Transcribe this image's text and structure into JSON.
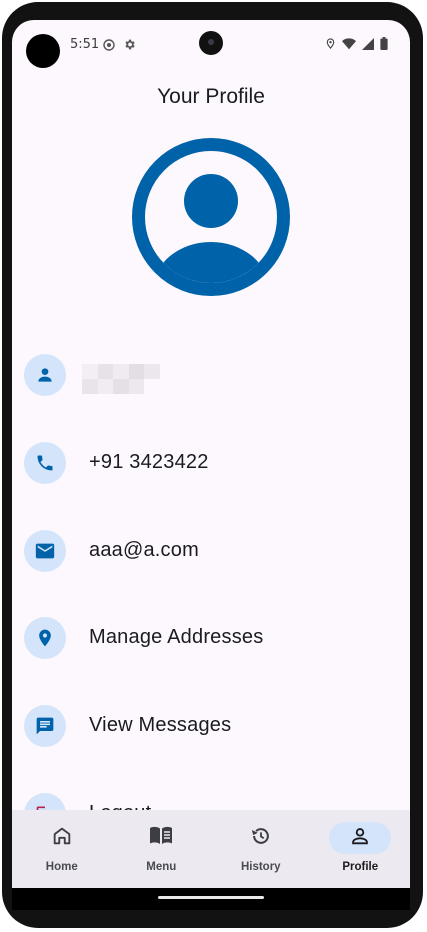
{
  "status_bar": {
    "time": "5:51",
    "left_icons": [
      "settings-dot-icon",
      "gear-icon"
    ],
    "right_icons": [
      "location-icon",
      "wifi-icon",
      "signal-icon",
      "battery-icon"
    ]
  },
  "header": {
    "title": "Your Profile"
  },
  "avatar": {
    "icon": "person-circle-icon",
    "color": "#0062a8"
  },
  "profile_items": [
    {
      "icon": "person-icon",
      "label": "",
      "redacted": true
    },
    {
      "icon": "phone-icon",
      "label": "+91 3423422"
    },
    {
      "icon": "email-icon",
      "label": "aaa@a.com"
    },
    {
      "icon": "location-pin-icon",
      "label": "Manage Addresses"
    },
    {
      "icon": "message-icon",
      "label": "View Messages"
    },
    {
      "icon": "logout-icon",
      "label": "Logout"
    }
  ],
  "bottom_nav": {
    "items": [
      {
        "icon": "home-icon",
        "label": "Home",
        "active": false
      },
      {
        "icon": "menu-book-icon",
        "label": "Menu",
        "active": false
      },
      {
        "icon": "history-icon",
        "label": "History",
        "active": false
      },
      {
        "icon": "profile-icon",
        "label": "Profile",
        "active": true
      }
    ]
  },
  "colors": {
    "accent": "#0062a8",
    "icon_bg": "#d3e4fb",
    "background": "#fdf8fd",
    "nav_bg": "#ece9f1",
    "logout_icon": "#b3264a"
  }
}
